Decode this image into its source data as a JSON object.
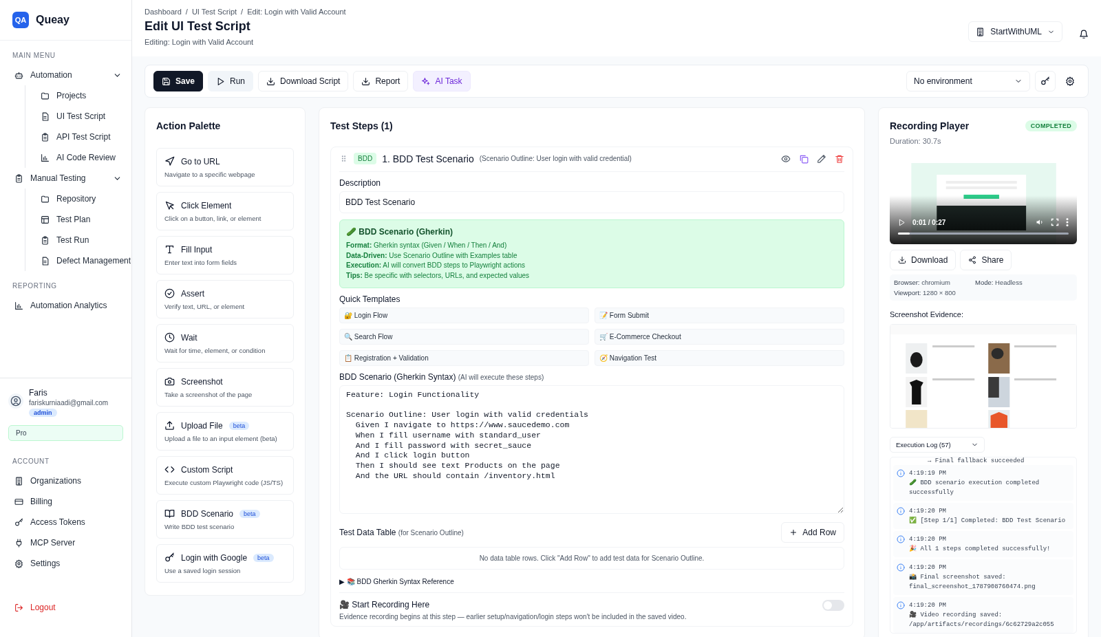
{
  "sidebar": {
    "logo_badge": "QA",
    "app_name": "Queay",
    "sections": [
      {
        "title": "MAIN MENU",
        "items": [
          {
            "label": "Automation",
            "expanded": true,
            "children": [
              {
                "label": "Projects"
              },
              {
                "label": "UI Test Script"
              },
              {
                "label": "API Test Script"
              },
              {
                "label": "AI Code Review"
              }
            ]
          },
          {
            "label": "Manual Testing",
            "expanded": true,
            "children": [
              {
                "label": "Repository"
              },
              {
                "label": "Test Plan"
              },
              {
                "label": "Test Run"
              },
              {
                "label": "Defect Management"
              }
            ]
          }
        ]
      },
      {
        "title": "REPORTING",
        "items": [
          {
            "label": "Automation Analytics"
          }
        ]
      }
    ],
    "user": {
      "name": "Faris",
      "email": "fariskurniaadi@gmail.com",
      "role": "admin"
    },
    "plan": "Pro",
    "account": {
      "title": "ACCOUNT",
      "items": [
        "Organizations",
        "Billing",
        "Access Tokens",
        "MCP Server",
        "Settings"
      ]
    },
    "logout": "Logout"
  },
  "header": {
    "breadcrumbs": [
      "Dashboard",
      "UI Test Script",
      "Edit: Login with Valid Account"
    ],
    "breadcrumb_separator": "/",
    "title": "Edit UI Test Script",
    "subtitle": "Editing: Login with Valid Account",
    "workspace": "StartWithUML"
  },
  "toolbar": {
    "buttons": [
      {
        "label": "Save",
        "kind": "primary"
      },
      {
        "label": "Run",
        "kind": "secondary"
      },
      {
        "label": "Download Script",
        "kind": "outline"
      },
      {
        "label": "Report",
        "kind": "outline"
      },
      {
        "label": "AI Task",
        "kind": "ai"
      }
    ],
    "environment": "No environment"
  },
  "palette": {
    "title": "Action Palette",
    "actions": [
      {
        "title": "Go to URL",
        "description": "Navigate to a specific webpage"
      },
      {
        "title": "Click Element",
        "description": "Click on a button, link, or element"
      },
      {
        "title": "Fill Input",
        "description": "Enter text into form fields"
      },
      {
        "title": "Assert",
        "description": "Verify text, URL, or element"
      },
      {
        "title": "Wait",
        "description": "Wait for time, element, or condition"
      },
      {
        "title": "Screenshot",
        "description": "Take a screenshot of the page"
      },
      {
        "title": "Upload File",
        "description": "Upload a file to an input element (beta)",
        "badge": "beta"
      },
      {
        "title": "Custom Script",
        "description": "Execute custom Playwright code (JS/TS)"
      },
      {
        "title": "BDD Scenario",
        "description": "Write BDD test scenario",
        "badge": "beta"
      },
      {
        "title": "Login with Google",
        "description": "Use a saved login session",
        "badge": "beta"
      }
    ]
  },
  "steps": {
    "title": "Test Steps (1)",
    "step": {
      "badge": "BDD",
      "title": "1. BDD Test Scenario",
      "subtitle": "(Scenario Outline: User login with valid credential)",
      "description_label": "Description",
      "description_value": "BDD Test Scenario",
      "info_title": "🥒 BDD Scenario (Gherkin)",
      "info_lines": [
        "**Format:** Gherkin syntax (Given / When / Then / And)",
        "**Data-Driven:** Use Scenario Outline with Examples table",
        "**Execution:** AI will convert BDD steps to Playwright actions",
        "**Tips:** Be specific with selectors, URLs, and expected values"
      ],
      "templates_label": "Quick Templates",
      "templates": [
        "🔐 Login Flow",
        "📝 Form Submit",
        "🔍 Search Flow",
        "🛒 E-Commerce Checkout",
        "📋 Registration + Validation",
        "🧭 Navigation Test"
      ],
      "script_label": "BDD Scenario (Gherkin Syntax)",
      "script_hint": "(AI will execute these steps)",
      "script": "Feature: Login Functionality\n\nScenario Outline: User login with valid credentials\n  Given I navigate to https://www.saucedemo.com\n  When I fill username with standard_user\n  And I fill password with secret_sauce\n  And I click login button\n  Then I should see text Products on the page\n  And the URL should contain /inventory.html",
      "table_label": "Test Data Table",
      "table_hint": "(for Scenario Outline)",
      "add_row": "Add Row",
      "table_empty": "No data table rows. Click \"Add Row\" to add test data for Scenario Outline.",
      "reference": {
        "marker": "▶",
        "label": "📚 BDD Gherkin Syntax Reference"
      },
      "recording": {
        "title": "🎥 Start Recording Here",
        "description": "Evidence recording begins at this step — earlier setup/navigation/login steps won't be included in the saved video.",
        "on": false
      }
    }
  },
  "recording": {
    "title": "Recording Player",
    "status": "COMPLETED",
    "duration": "Duration: 30.7s",
    "time": "0:01 / 0:27",
    "level": 0.07,
    "actions": [
      "Download",
      "Share"
    ],
    "meta": [
      {
        "label": "Browser:",
        "value": "chromium"
      },
      {
        "label": "Mode:",
        "value": "Headless"
      },
      {
        "label": "Viewport:",
        "value": "1280 × 800"
      }
    ],
    "evidence_label": "Screenshot Evidence:",
    "log_select": "Execution Log (57)",
    "log": [
      {
        "kind": "continuation",
        "message": "→ Final fallback succeeded"
      },
      {
        "kind": "entry",
        "time": "4:19:19 PM",
        "message": "🥒 BDD scenario execution completed successfully"
      },
      {
        "kind": "entry",
        "time": "4:19:20 PM",
        "message": "✅ [Step 1/1] Completed: BDD Test Scenario"
      },
      {
        "kind": "entry",
        "time": "4:19:20 PM",
        "message": "🎉 All 1 steps completed successfully!"
      },
      {
        "kind": "entry",
        "time": "4:19:20 PM",
        "message": "📸 Final screenshot saved: final_screenshot_1787908760474.png"
      },
      {
        "kind": "entry",
        "time": "4:19:20 PM",
        "message": "🎥 Video recording saved: /app/artifacts/recordings/6c62729a2c055"
      }
    ]
  }
}
